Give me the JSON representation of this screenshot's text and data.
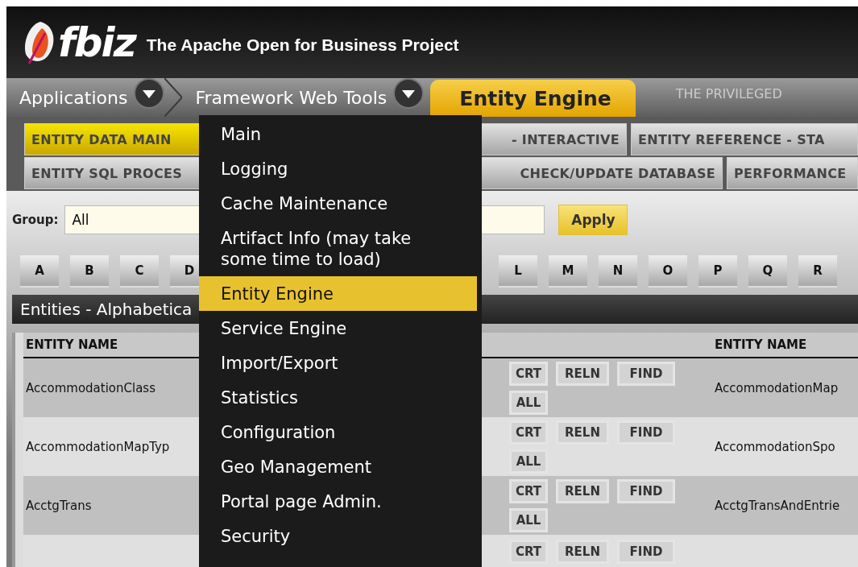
{
  "header": {
    "logo": "fbiz",
    "tagline": "The Apache Open for Business Project",
    "notice": "THE PRIVILEGED"
  },
  "nav": [
    {
      "label": "Applications",
      "kind": "menu",
      "selected": false
    },
    {
      "label": "Framework Web Tools",
      "kind": "menu",
      "selected": false
    },
    {
      "label": "Entity Engine",
      "kind": "current",
      "selected": true
    }
  ],
  "subtabs_row1": [
    {
      "label": "ENTITY DATA MAIN",
      "selected": true
    },
    {
      "label": "- INTERACTIVE",
      "selected": false
    },
    {
      "label": "ENTITY REFERENCE - STA",
      "selected": false
    }
  ],
  "subtabs_row2": [
    {
      "label": "ENTITY SQL PROCES",
      "selected": false
    },
    {
      "label": "CHECK/UPDATE DATABASE",
      "selected": false
    },
    {
      "label": "PERFORMANCE",
      "selected": false
    }
  ],
  "filter": {
    "group_label": "Group:",
    "group_value": "All",
    "apply": "Apply"
  },
  "letters_left": [
    "A",
    "B",
    "C",
    "D"
  ],
  "letters_right": [
    "L",
    "M",
    "N",
    "O",
    "P",
    "Q",
    "R"
  ],
  "panel": {
    "title": "Entities - Alphabetica",
    "columns": [
      "ENTITY NAME",
      "ENTITY NAME"
    ],
    "rows": [
      {
        "left": "AccommodationClass",
        "actions": [
          "CRT",
          "RELN",
          "FIND",
          "ALL"
        ],
        "right": "AccommodationMap"
      },
      {
        "left": "AccommodationMapTyp",
        "actions": [
          "CRT",
          "RELN",
          "FIND",
          "ALL"
        ],
        "right": "AccommodationSpo"
      },
      {
        "left": "AcctgTrans",
        "actions": [
          "CRT",
          "RELN",
          "FIND",
          "ALL"
        ],
        "right": "AcctgTransAndEntrie"
      },
      {
        "actions": [
          "CRT",
          "RELN",
          "FIND"
        ]
      }
    ]
  },
  "menu": {
    "items": [
      {
        "label": "Main",
        "selected": false
      },
      {
        "label": "Logging",
        "selected": false
      },
      {
        "label": "Cache Maintenance",
        "selected": false
      },
      {
        "label": "Artifact Info (may take some time to load)",
        "selected": false
      },
      {
        "label": "Entity Engine",
        "selected": true
      },
      {
        "label": "Service Engine",
        "selected": false
      },
      {
        "label": "Import/Export",
        "selected": false
      },
      {
        "label": "Statistics",
        "selected": false
      },
      {
        "label": "Configuration",
        "selected": false
      },
      {
        "label": "Geo Management",
        "selected": false
      },
      {
        "label": "Portal page Admin.",
        "selected": false
      },
      {
        "label": "Security",
        "selected": false
      }
    ]
  }
}
